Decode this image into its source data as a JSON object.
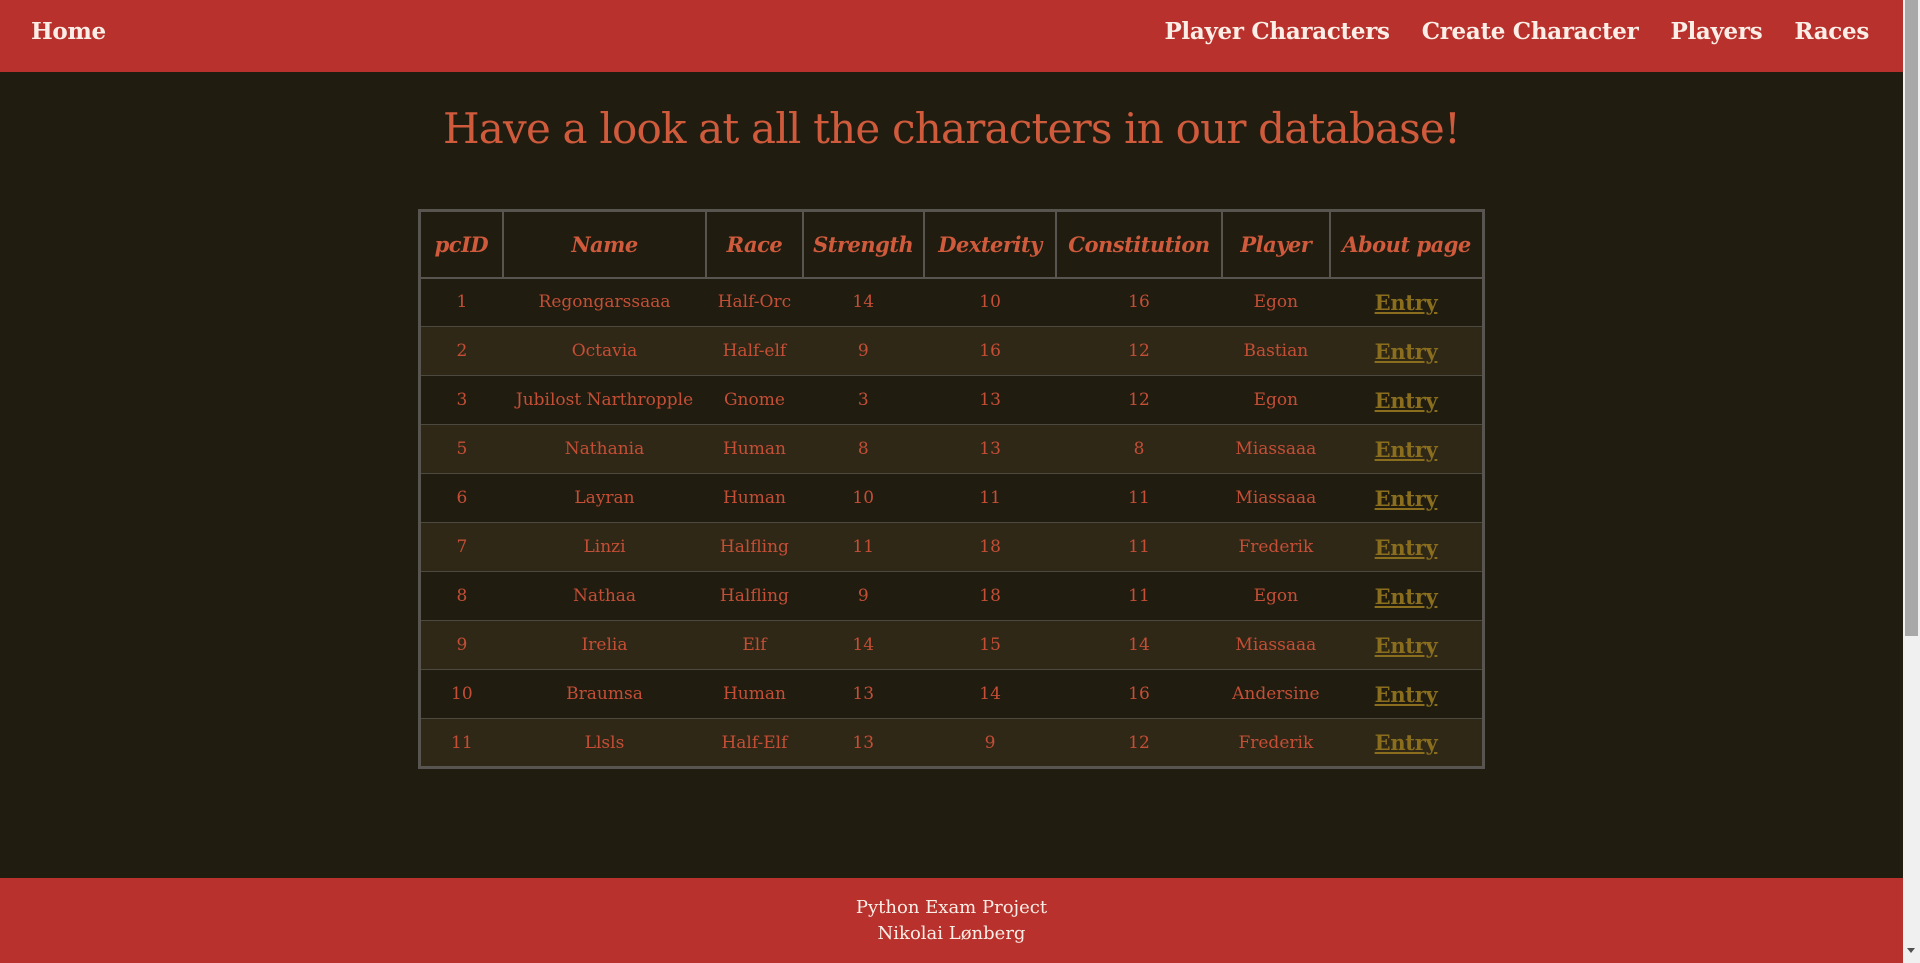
{
  "nav": {
    "home": "Home",
    "links": [
      "Player Characters",
      "Create Character",
      "Players",
      "Races"
    ]
  },
  "main": {
    "title": "Have a look at all the characters in our database!"
  },
  "table": {
    "headers": [
      "pcID",
      "Name",
      "Race",
      "Strength",
      "Dexterity",
      "Constitution",
      "Player",
      "About page"
    ],
    "rows": [
      {
        "pcid": "1",
        "name": "Regongarssaaa",
        "race": "Half-Orc",
        "strength": "14",
        "dexterity": "10",
        "constitution": "16",
        "player": "Egon",
        "link": "Entry"
      },
      {
        "pcid": "2",
        "name": "Octavia",
        "race": "Half-elf",
        "strength": "9",
        "dexterity": "16",
        "constitution": "12",
        "player": "Bastian",
        "link": "Entry"
      },
      {
        "pcid": "3",
        "name": "Jubilost Narthropple",
        "race": "Gnome",
        "strength": "3",
        "dexterity": "13",
        "constitution": "12",
        "player": "Egon",
        "link": "Entry"
      },
      {
        "pcid": "5",
        "name": "Nathania",
        "race": "Human",
        "strength": "8",
        "dexterity": "13",
        "constitution": "8",
        "player": "Miassaaa",
        "link": "Entry"
      },
      {
        "pcid": "6",
        "name": "Layran",
        "race": "Human",
        "strength": "10",
        "dexterity": "11",
        "constitution": "11",
        "player": "Miassaaa",
        "link": "Entry"
      },
      {
        "pcid": "7",
        "name": "Linzi",
        "race": "Halfling",
        "strength": "11",
        "dexterity": "18",
        "constitution": "11",
        "player": "Frederik",
        "link": "Entry"
      },
      {
        "pcid": "8",
        "name": "Nathaa",
        "race": "Halfling",
        "strength": "9",
        "dexterity": "18",
        "constitution": "11",
        "player": "Egon",
        "link": "Entry"
      },
      {
        "pcid": "9",
        "name": "Irelia",
        "race": "Elf",
        "strength": "14",
        "dexterity": "15",
        "constitution": "14",
        "player": "Miassaaa",
        "link": "Entry"
      },
      {
        "pcid": "10",
        "name": "Braumsa",
        "race": "Human",
        "strength": "13",
        "dexterity": "14",
        "constitution": "16",
        "player": "Andersine",
        "link": "Entry"
      },
      {
        "pcid": "11",
        "name": "Llsls",
        "race": "Half-Elf",
        "strength": "13",
        "dexterity": "9",
        "constitution": "12",
        "player": "Frederik",
        "link": "Entry"
      }
    ]
  },
  "footer": {
    "line1": "Python Exam Project",
    "line2": "Nikolai Lønberg"
  },
  "colors": {
    "nav_bg": "#b8312d",
    "page_bg": "#201d10",
    "title": "#d05a3c",
    "link": "#8a6e1e"
  }
}
